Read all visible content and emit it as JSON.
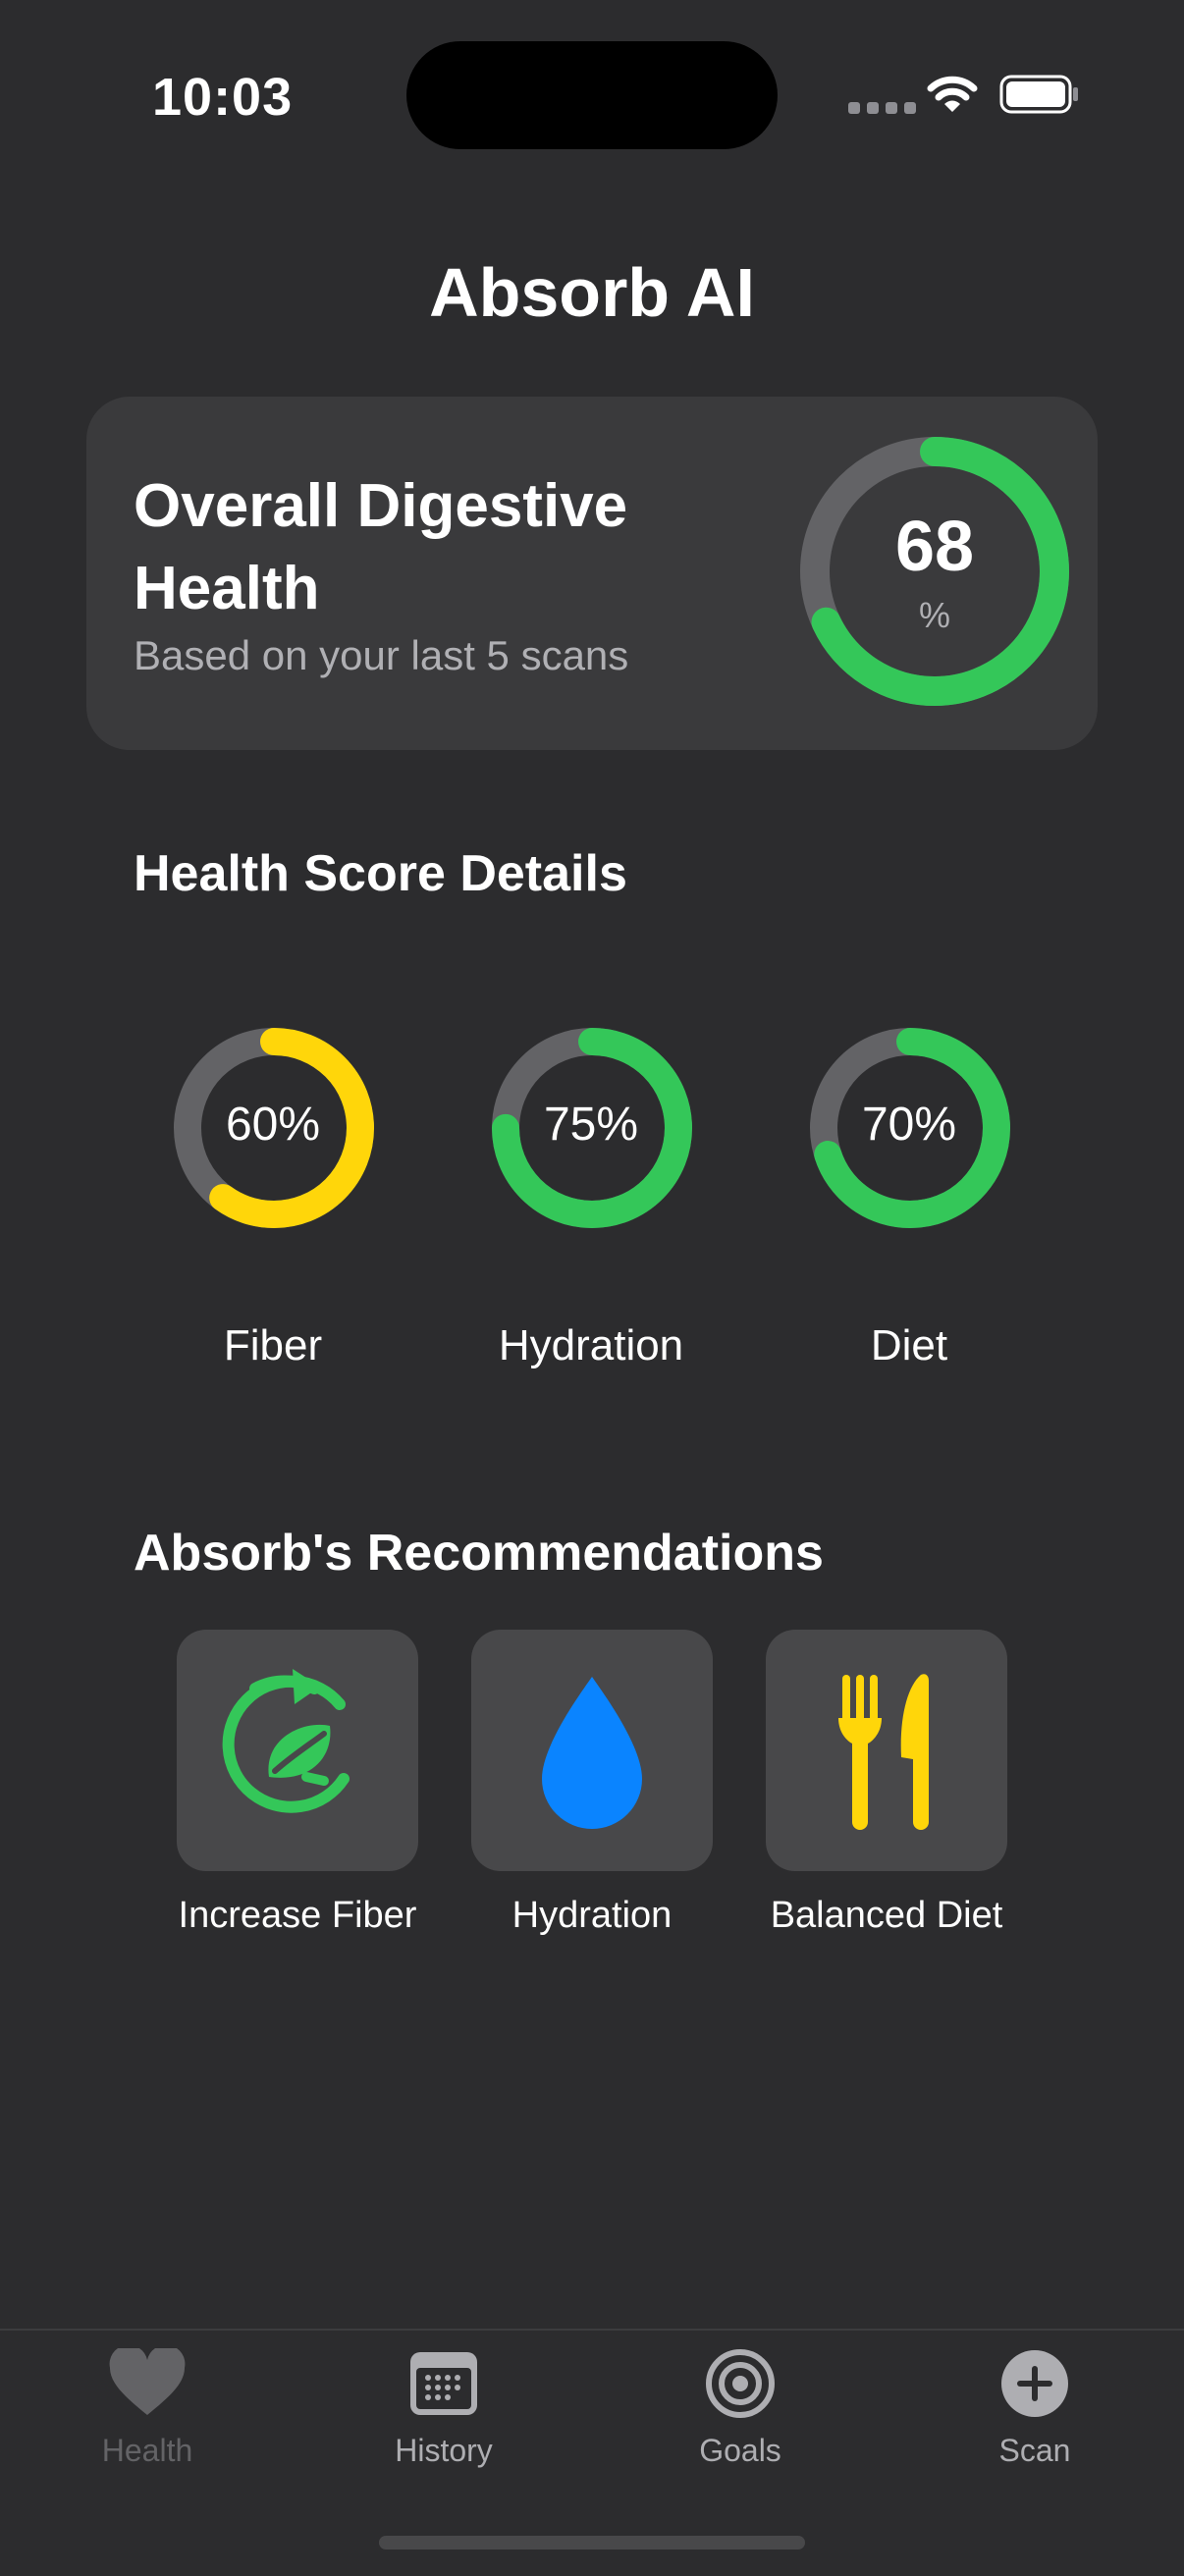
{
  "status_bar": {
    "time": "10:03"
  },
  "header": {
    "title": "Absorb AI"
  },
  "overall": {
    "title": "Overall Digestive Health",
    "subtitle": "Based on your last 5 scans",
    "score": "68",
    "unit": "%",
    "fraction": 0.68,
    "color": "#34c759"
  },
  "details": {
    "title": "Health Score Details",
    "metrics": [
      {
        "label": "Fiber",
        "value": "60%",
        "fraction": 0.6,
        "color": "#ffd60a"
      },
      {
        "label": "Hydration",
        "value": "75%",
        "fraction": 0.75,
        "color": "#34c759"
      },
      {
        "label": "Diet",
        "value": "70%",
        "fraction": 0.7,
        "color": "#34c759"
      }
    ]
  },
  "recommendations": {
    "title": "Absorb's Recommendations",
    "items": [
      {
        "label": "Increase Fiber",
        "icon": "leaf-refresh-icon",
        "color": "#34c759"
      },
      {
        "label": "Hydration",
        "icon": "water-drop-icon",
        "color": "#0a84ff"
      },
      {
        "label": "Balanced Diet",
        "icon": "fork-knife-icon",
        "color": "#ffd60a"
      }
    ]
  },
  "tab_bar": {
    "tabs": [
      {
        "label": "Health",
        "icon": "heart-icon"
      },
      {
        "label": "History",
        "icon": "calendar-icon"
      },
      {
        "label": "Goals",
        "icon": "target-icon"
      },
      {
        "label": "Scan",
        "icon": "plus-circle-icon"
      }
    ]
  },
  "colors": {
    "background": "#2c2c2e",
    "card": "#3a3a3c",
    "ring_track": "#636366"
  }
}
